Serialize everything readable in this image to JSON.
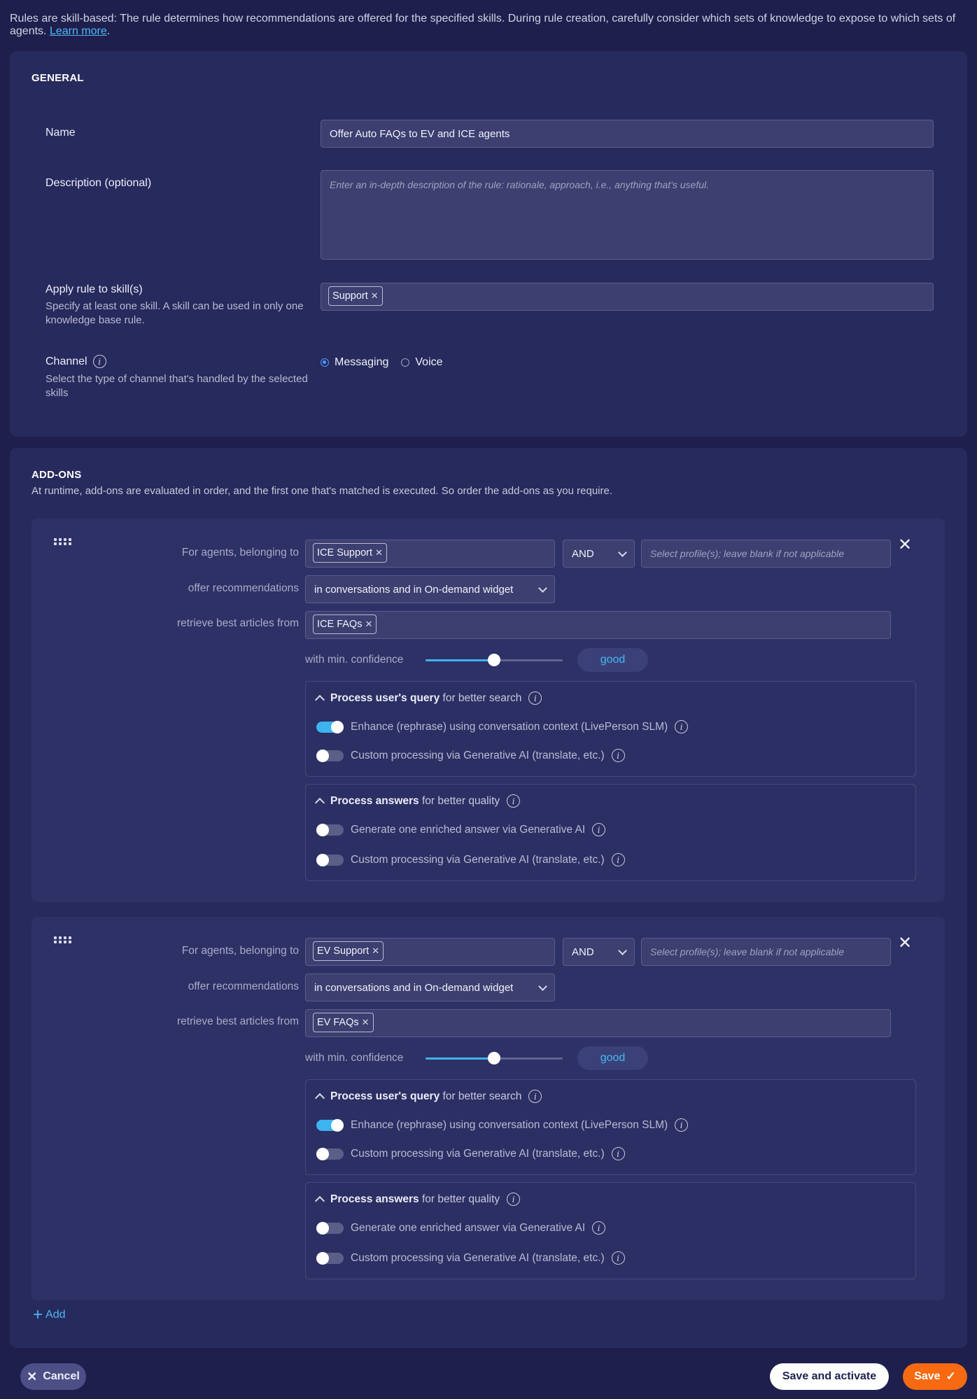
{
  "intro": {
    "text": "Rules are skill-based: The rule determines how recommendations are offered for the specified skills. During rule creation, carefully consider which sets of knowledge to expose to which sets of agents.",
    "link": "Learn more"
  },
  "general": {
    "title": "GENERAL",
    "name_label": "Name",
    "name_value": "Offer Auto FAQs to EV and ICE agents",
    "description_label": "Description (optional)",
    "description_placeholder": "Enter an in-depth description of the rule: rationale, approach, i.e., anything that's useful.",
    "skills_label": "Apply rule to skill(s)",
    "skills_hint": "Specify at least one skill. A skill can be used in only one knowledge base rule.",
    "skills": [
      "Support"
    ],
    "channel_label": "Channel",
    "channel_hint": "Select the type of channel that's handled by the selected skills",
    "channel_options": [
      "Messaging",
      "Voice"
    ],
    "channel_selected": "Messaging"
  },
  "addons": {
    "title": "ADD-ONS",
    "subtitle": "At runtime, add-ons are evaluated in order, and the first one that's matched is executed. So order the add-ons as you require.",
    "labels": {
      "agents": "For agents, belonging to",
      "offer": "offer recommendations",
      "retrieve": "retrieve best articles from",
      "confidence": "with min. confidence",
      "profile_placeholder": "Select profile(s); leave blank if not applicable",
      "query_bold": "Process user's query",
      "query_rest": "for better search",
      "answers_bold": "Process answers",
      "answers_rest": "for better quality",
      "enhance": "Enhance (rephrase) using conversation context (LivePerson SLM)",
      "custom": "Custom processing via Generative AI (translate, etc.)",
      "enriched": "Generate one enriched answer via Generative AI"
    },
    "items": [
      {
        "skill": "ICE Support",
        "operator": "AND",
        "offer": "in conversations and in On-demand widget",
        "kb": "ICE FAQs",
        "confidence": "good",
        "confidence_level": 0.5,
        "enhance_on": true,
        "custom_query_on": false,
        "enriched_on": false,
        "custom_answer_on": false
      },
      {
        "skill": "EV Support",
        "operator": "AND",
        "offer": "in conversations and in On-demand widget",
        "kb": "EV FAQs",
        "confidence": "good",
        "confidence_level": 0.5,
        "enhance_on": true,
        "custom_query_on": false,
        "enriched_on": false,
        "custom_answer_on": false
      }
    ],
    "add_label": "Add"
  },
  "footer": {
    "cancel": "Cancel",
    "save_activate": "Save and activate",
    "save": "Save"
  }
}
